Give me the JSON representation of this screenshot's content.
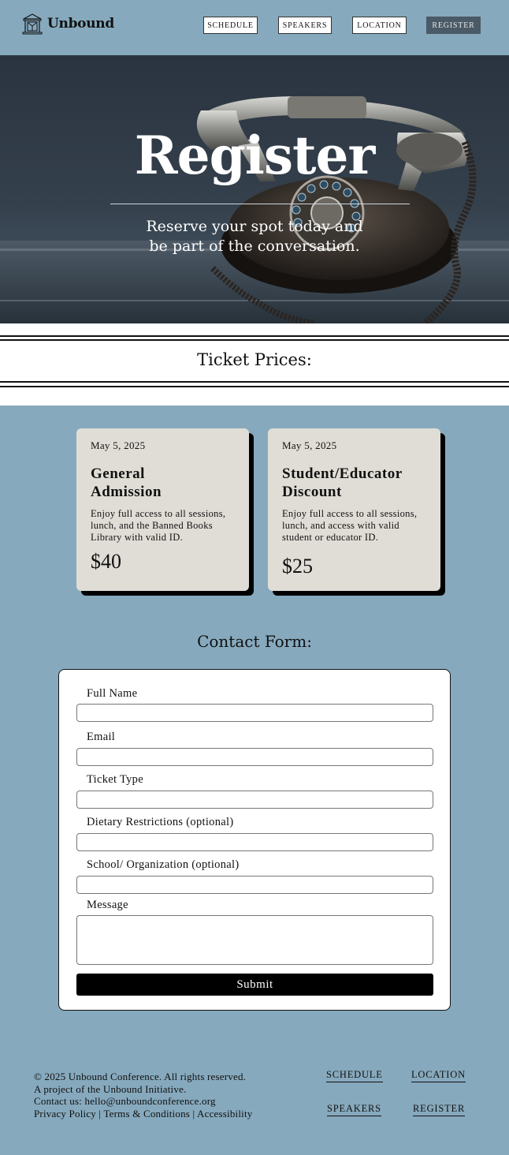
{
  "header": {
    "logo_text": "Unbound",
    "nav": [
      {
        "label": "SCHEDULE"
      },
      {
        "label": "SPEAKERS"
      },
      {
        "label": "LOCATION"
      },
      {
        "label": "REGISTER"
      }
    ]
  },
  "hero": {
    "title": "Register",
    "subtitle_line1": "Reserve your spot today and",
    "subtitle_line2": "be part of the conversation."
  },
  "tickets": {
    "section_title": "Ticket Prices:",
    "cards": [
      {
        "date": "May 5, 2025",
        "title_line1": "General",
        "title_line2": "Admission",
        "desc_line1": "Enjoy full access to all sessions,",
        "desc_line2": "lunch, and the Banned Books",
        "desc_line3": "Library with valid ID.",
        "price": "$40"
      },
      {
        "date": "May 5, 2025",
        "title_line1": "Student/Educator",
        "title_line2": "Discount",
        "desc_line1": "Enjoy full access to all sessions,",
        "desc_line2": "lunch, and access with valid",
        "desc_line3": "student or educator ID.",
        "price": "$25"
      }
    ]
  },
  "contact": {
    "section_title": "Contact Form:",
    "fields": [
      {
        "label": "Full Name",
        "value": ""
      },
      {
        "label": "Email",
        "value": ""
      },
      {
        "label": "Ticket Type",
        "value": ""
      },
      {
        "label": "Dietary Restrictions (optional)",
        "value": ""
      },
      {
        "label": "School/ Organization (optional)",
        "value": ""
      },
      {
        "label": "Message",
        "value": ""
      }
    ],
    "submit_label": "Submit"
  },
  "footer": {
    "copyright": "© 2025 Unbound Conference. All rights reserved.",
    "project": "A project of the Unbound Initiative.",
    "contact": "Contact us: hello@unboundconference.org",
    "legal": "Privacy Policy | Terms & Conditions | Accessibility",
    "links": [
      {
        "label": "SCHEDULE"
      },
      {
        "label": "LOCATION"
      },
      {
        "label": "SPEAKERS"
      },
      {
        "label": "REGISTER"
      }
    ]
  },
  "colors": {
    "page_bg": "#86a9bd",
    "card_bg": "#e0ddd6",
    "register_btn": "#4a5a66"
  },
  "icons": {
    "logo": "library-building-icon"
  }
}
